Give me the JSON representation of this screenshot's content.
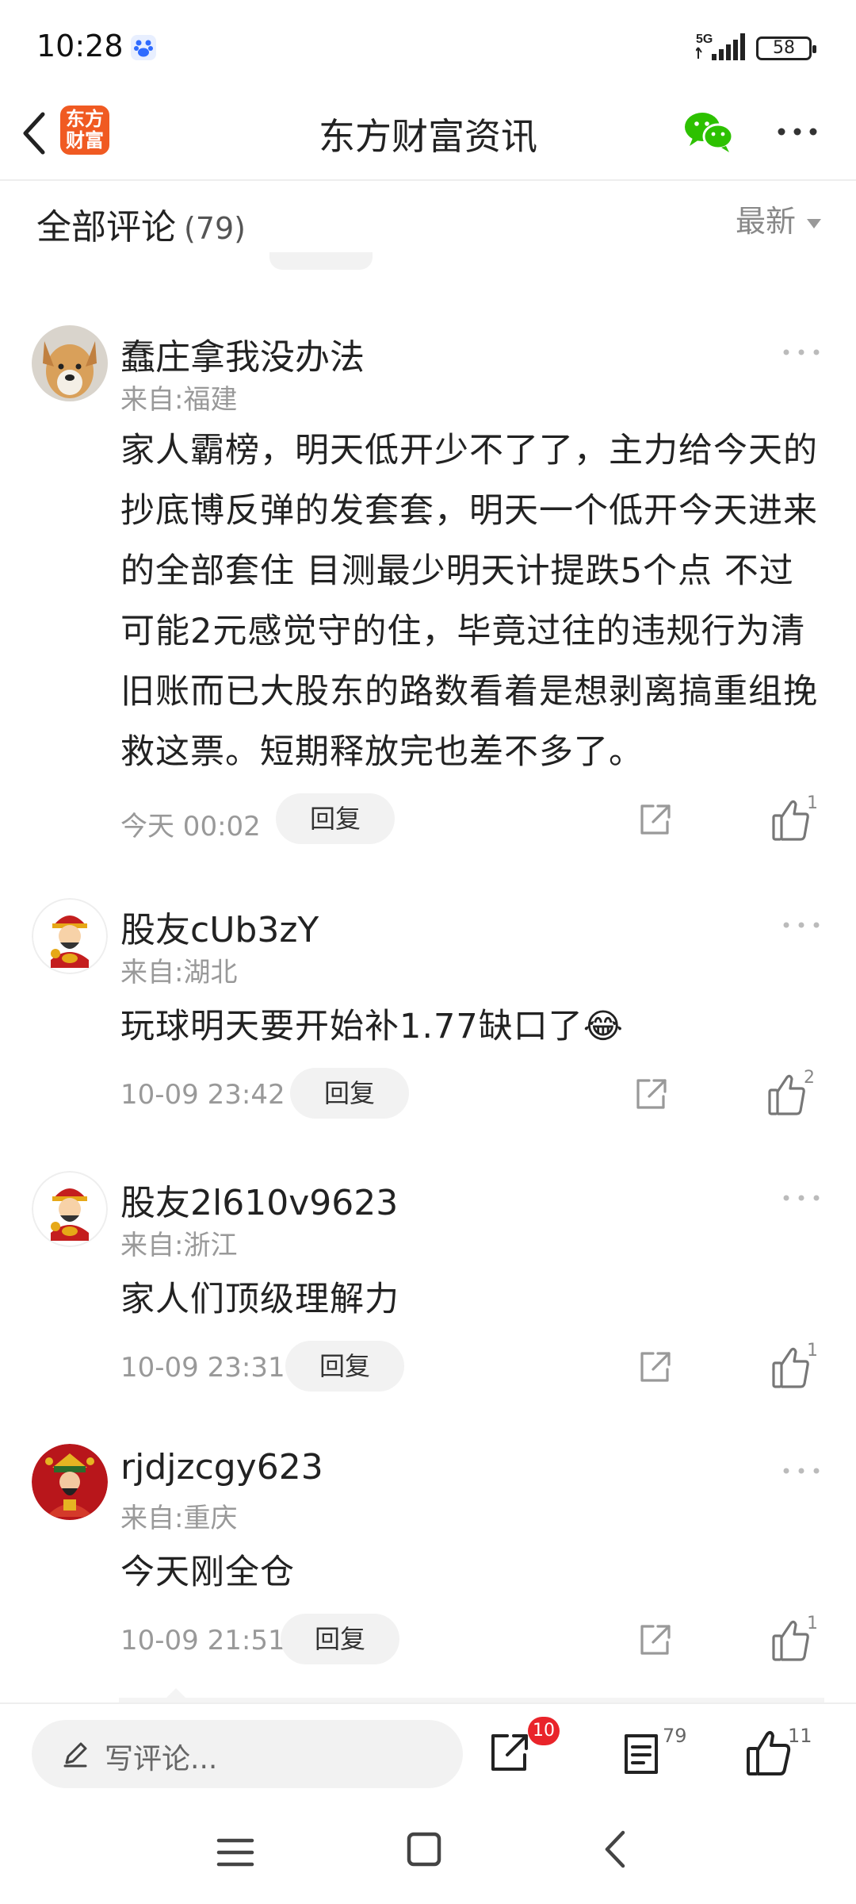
{
  "status_bar": {
    "time": "10:28",
    "network": "5G",
    "battery": "58"
  },
  "header": {
    "title": "东方财富资讯",
    "logo_text_line1": "东方",
    "logo_text_line2": "财富",
    "brand_color": "#f05a22",
    "wechat_color": "#2dc100"
  },
  "comments_section": {
    "title": "全部评论",
    "count": "(79)",
    "sort_label": "最新"
  },
  "comments": [
    {
      "username": "蠢庄拿我没办法",
      "location": "来自:福建",
      "body": "家人霸榜，明天低开少不了了，主力给今天的抄底博反弹的发套套，明天一个低开今天进来的全部套住 目测最少明天计提跌5个点 不过可能2元感觉守的住，毕竟过往的违规行为清旧账而已大股东的路数看着是想剥离搞重组挽救这票。短期释放完也差不多了。",
      "timestamp": "今天 00:02",
      "reply_label": "回复",
      "likes": "1"
    },
    {
      "username": "股友cUb3zY",
      "location": "来自:湖北",
      "body": "玩球明天要开始补1.77缺口了😂",
      "timestamp": "10-09 23:42",
      "reply_label": "回复",
      "likes": "2"
    },
    {
      "username": "股友2l610v9623",
      "location": "来自:浙江",
      "body": "家人们顶级理解力",
      "timestamp": "10-09 23:31",
      "reply_label": "回复",
      "likes": "1"
    },
    {
      "username": "rjdjzcgy623",
      "location": "来自:重庆",
      "body": "今天刚全仓",
      "timestamp": "10-09 21:51",
      "reply_label": "回复",
      "likes": "1"
    }
  ],
  "bottom_bar": {
    "compose_placeholder": "写评论...",
    "share_badge": "10",
    "comments_count": "79",
    "likes_count": "11",
    "badge_color": "#e9242a"
  }
}
